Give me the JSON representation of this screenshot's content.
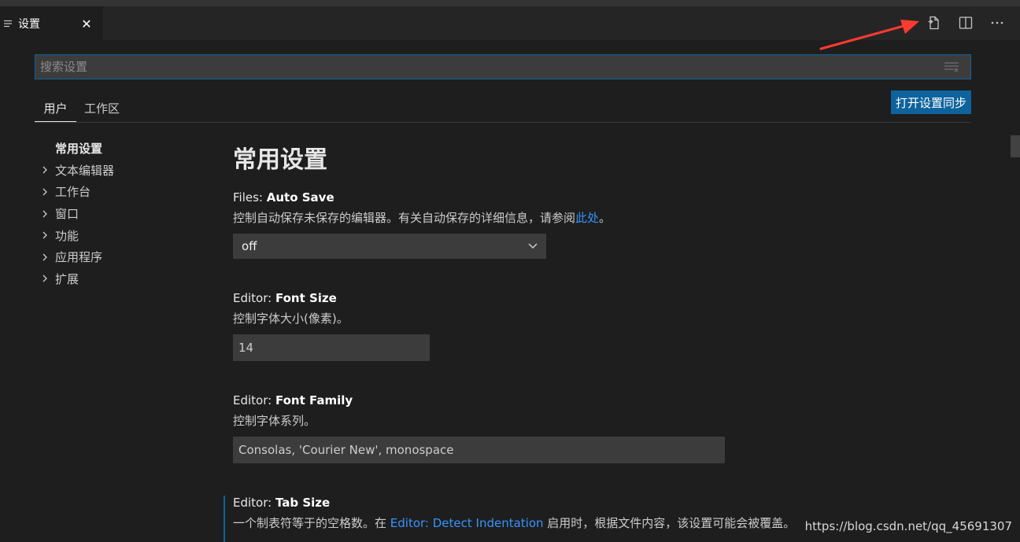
{
  "tab": {
    "title": "设置",
    "close": "✕"
  },
  "search": {
    "placeholder": "搜索设置"
  },
  "scopes": {
    "user": "用户",
    "workspace": "工作区",
    "sync_button": "打开设置同步"
  },
  "toc": [
    {
      "label": "常用设置",
      "active": true
    },
    {
      "label": "文本编辑器"
    },
    {
      "label": "工作台"
    },
    {
      "label": "窗口"
    },
    {
      "label": "功能"
    },
    {
      "label": "应用程序"
    },
    {
      "label": "扩展"
    }
  ],
  "section": {
    "title": "常用设置"
  },
  "settings": {
    "auto_save": {
      "category": "Files: ",
      "name": "Auto Save",
      "desc": "控制自动保存未保存的编辑器。有关自动保存的详细信息，请参阅",
      "link": "此处",
      "desc_end": "。",
      "value": "off"
    },
    "font_size": {
      "category": "Editor: ",
      "name": "Font Size",
      "desc": "控制字体大小(像素)。",
      "value": "14"
    },
    "font_family": {
      "category": "Editor: ",
      "name": "Font Family",
      "desc": "控制字体系列。",
      "value": "Consolas, 'Courier New', monospace"
    },
    "tab_size": {
      "category": "Editor: ",
      "name": "Tab Size",
      "desc_start": "一个制表符等于的空格数。在 ",
      "link": "Editor: Detect Indentation",
      "desc_end": " 启用时，根据文件内容，该设置可能会被覆盖。"
    }
  },
  "watermark": "https://blog.csdn.net/qq_45691307",
  "colors": {
    "accent": "#0e639c",
    "link": "#3794ff",
    "annotation_arrow": "#ff3b30"
  }
}
